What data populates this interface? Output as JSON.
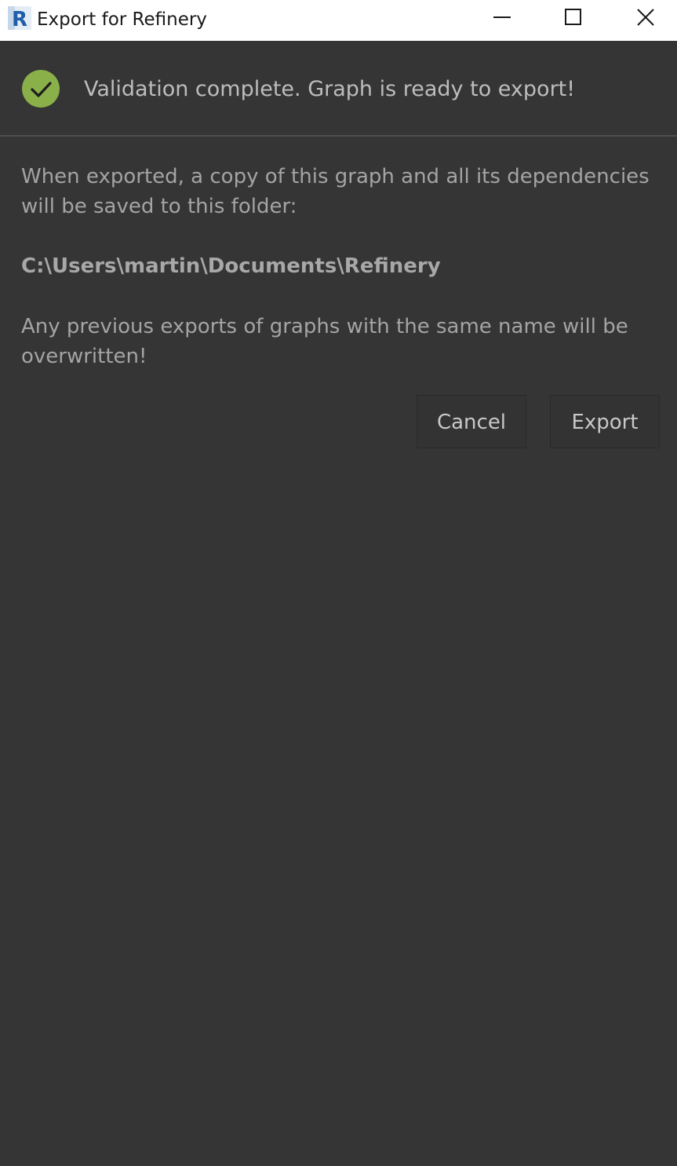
{
  "window": {
    "title": "Export for Refinery",
    "app_icon": "revit-r-icon",
    "controls": {
      "minimize_icon": "minimize-icon",
      "maximize_icon": "maximize-icon",
      "close_icon": "close-icon"
    }
  },
  "status": {
    "icon": "check-circle-icon",
    "icon_color": "#8ab04a",
    "message": "Validation complete. Graph is ready to export!"
  },
  "body": {
    "intro": "When exported, a copy of this graph and all its dependencies will be saved to this folder:",
    "folder_path": "C:\\Users\\martin\\Documents\\Refinery",
    "warning": "Any previous exports of graphs with the same name will be overwritten!"
  },
  "actions": {
    "cancel_label": "Cancel",
    "export_label": "Export"
  }
}
